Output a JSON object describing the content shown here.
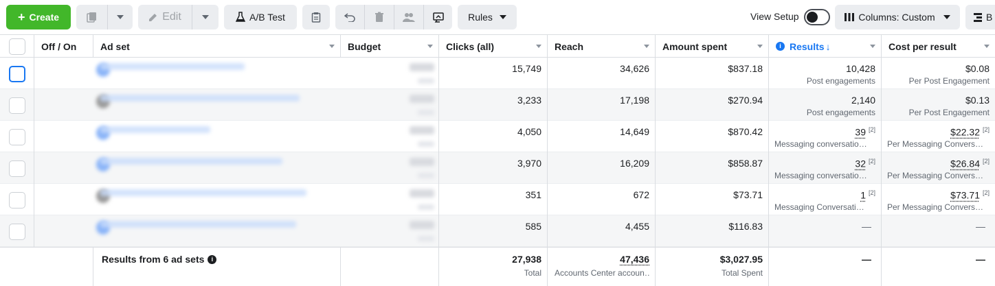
{
  "toolbar": {
    "create_label": "Create",
    "edit_label": "Edit",
    "ab_test_label": "A/B Test",
    "rules_label": "Rules",
    "view_setup_label": "View Setup",
    "columns_label": "Columns: Custom",
    "breakdown_label": "B"
  },
  "table": {
    "headers": {
      "off_on": "Off / On",
      "ad_set": "Ad set",
      "budget": "Budget",
      "clicks": "Clicks (all)",
      "reach": "Reach",
      "amount": "Amount spent",
      "results": "Results",
      "cost": "Cost per result"
    },
    "rows": [
      {
        "clicks": "15,749",
        "reach": "34,626",
        "amount": "$837.18",
        "results": "10,428",
        "results_sub": "Post engagements",
        "results_sup": "",
        "cost": "$0.08",
        "cost_sub": "Per Post Engagement",
        "cost_sup": ""
      },
      {
        "clicks": "3,233",
        "reach": "17,198",
        "amount": "$270.94",
        "results": "2,140",
        "results_sub": "Post engagements",
        "results_sup": "",
        "cost": "$0.13",
        "cost_sub": "Per Post Engagement",
        "cost_sup": ""
      },
      {
        "clicks": "4,050",
        "reach": "14,649",
        "amount": "$870.42",
        "results": "39",
        "results_sub": "Messaging conversatio…",
        "results_sup": "[2]",
        "cost": "$22.32",
        "cost_sub": "Per Messaging Convers…",
        "cost_sup": "[2]"
      },
      {
        "clicks": "3,970",
        "reach": "16,209",
        "amount": "$858.87",
        "results": "32",
        "results_sub": "Messaging conversatio…",
        "results_sup": "[2]",
        "cost": "$26.84",
        "cost_sub": "Per Messaging Convers…",
        "cost_sup": "[2]"
      },
      {
        "clicks": "351",
        "reach": "672",
        "amount": "$73.71",
        "results": "1",
        "results_sub": "Messaging Conversati…",
        "results_sup": "[2]",
        "cost": "$73.71",
        "cost_sub": "Per Messaging Convers…",
        "cost_sup": "[2]"
      },
      {
        "clicks": "585",
        "reach": "4,455",
        "amount": "$116.83",
        "results": "—",
        "results_sub": "",
        "results_sup": "",
        "cost": "—",
        "cost_sub": "",
        "cost_sup": ""
      }
    ],
    "footer": {
      "label": "Results from 6 ad sets",
      "clicks": "27,938",
      "clicks_sub": "Total",
      "reach": "47,436",
      "reach_sub": "Accounts Center accoun…",
      "amount": "$3,027.95",
      "amount_sub": "Total Spent",
      "results": "—",
      "cost": "—"
    }
  },
  "colors": {
    "accent": "#1877f2",
    "create": "#42b72a"
  }
}
